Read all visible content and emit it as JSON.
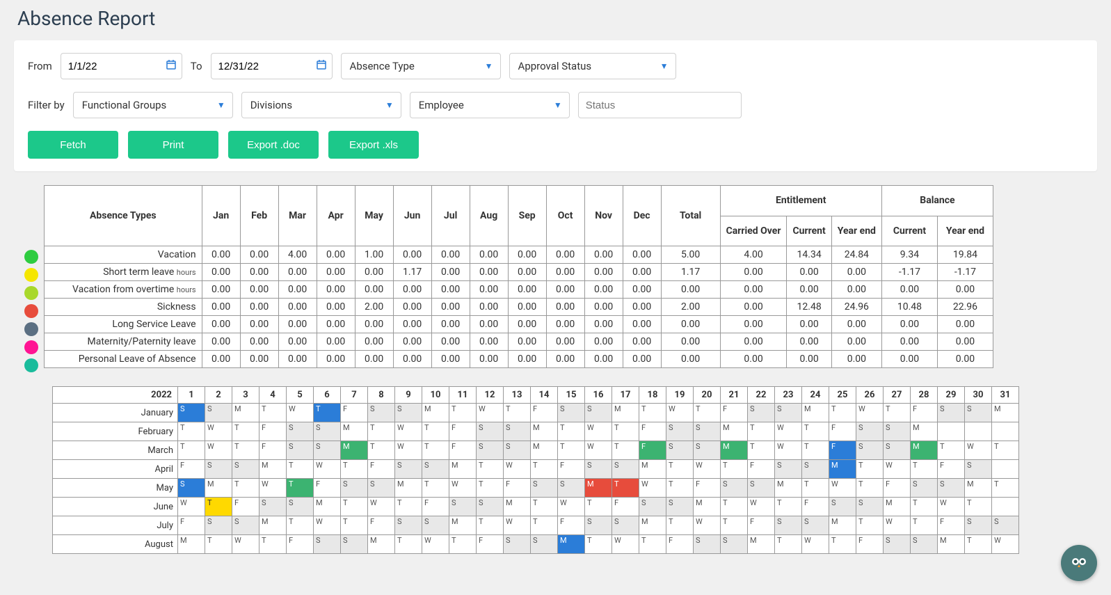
{
  "page_title": "Absence Report",
  "filters": {
    "from_label": "From",
    "from_value": "1/1/22",
    "to_label": "To",
    "to_value": "12/31/22",
    "absence_type_label": "Absence Type",
    "approval_status_label": "Approval Status",
    "filter_by_label": "Filter by",
    "functional_groups_label": "Functional Groups",
    "divisions_label": "Divisions",
    "employee_label": "Employee",
    "status_placeholder": "Status"
  },
  "buttons": {
    "fetch": "Fetch",
    "print": "Print",
    "export_doc": "Export .doc",
    "export_xls": "Export .xls"
  },
  "summary": {
    "headers": {
      "types": "Absence Types",
      "months": [
        "Jan",
        "Feb",
        "Mar",
        "Apr",
        "May",
        "Jun",
        "Jul",
        "Aug",
        "Sep",
        "Oct",
        "Nov",
        "Dec"
      ],
      "total": "Total",
      "entitlement": "Entitlement",
      "balance": "Balance",
      "carried_over": "Carried Over",
      "current": "Current",
      "year_end": "Year end",
      "bal_current": "Current",
      "bal_year_end": "Year end"
    },
    "rows": [
      {
        "color": "#2ecc40",
        "label": "Vacation",
        "unit": "",
        "months": [
          "0.00",
          "0.00",
          "4.00",
          "0.00",
          "1.00",
          "0.00",
          "0.00",
          "0.00",
          "0.00",
          "0.00",
          "0.00",
          "0.00"
        ],
        "total": "5.00",
        "carried": "4.00",
        "ent_current": "14.34",
        "ent_year_end": "24.84",
        "bal_current": "9.34",
        "bal_year_end": "19.84"
      },
      {
        "color": "#f5e600",
        "label": "Short term leave",
        "unit": "hours",
        "months": [
          "0.00",
          "0.00",
          "0.00",
          "0.00",
          "0.00",
          "1.17",
          "0.00",
          "0.00",
          "0.00",
          "0.00",
          "0.00",
          "0.00"
        ],
        "total": "1.17",
        "carried": "0.00",
        "ent_current": "0.00",
        "ent_year_end": "0.00",
        "bal_current": "-1.17",
        "bal_year_end": "-1.17"
      },
      {
        "color": "#a8d82b",
        "label": "Vacation from overtime",
        "unit": "hours",
        "months": [
          "0.00",
          "0.00",
          "0.00",
          "0.00",
          "0.00",
          "0.00",
          "0.00",
          "0.00",
          "0.00",
          "0.00",
          "0.00",
          "0.00"
        ],
        "total": "0.00",
        "carried": "0.00",
        "ent_current": "0.00",
        "ent_year_end": "0.00",
        "bal_current": "0.00",
        "bal_year_end": "0.00"
      },
      {
        "color": "#e74c3c",
        "label": "Sickness",
        "unit": "",
        "months": [
          "0.00",
          "0.00",
          "0.00",
          "0.00",
          "2.00",
          "0.00",
          "0.00",
          "0.00",
          "0.00",
          "0.00",
          "0.00",
          "0.00"
        ],
        "total": "2.00",
        "carried": "0.00",
        "ent_current": "12.48",
        "ent_year_end": "24.96",
        "bal_current": "10.48",
        "bal_year_end": "22.96"
      },
      {
        "color": "#5b6f82",
        "label": "Long Service Leave",
        "unit": "",
        "months": [
          "0.00",
          "0.00",
          "0.00",
          "0.00",
          "0.00",
          "0.00",
          "0.00",
          "0.00",
          "0.00",
          "0.00",
          "0.00",
          "0.00"
        ],
        "total": "0.00",
        "carried": "0.00",
        "ent_current": "0.00",
        "ent_year_end": "0.00",
        "bal_current": "0.00",
        "bal_year_end": "0.00"
      },
      {
        "color": "#ff1493",
        "label": "Maternity/Paternity leave",
        "unit": "",
        "months": [
          "0.00",
          "0.00",
          "0.00",
          "0.00",
          "0.00",
          "0.00",
          "0.00",
          "0.00",
          "0.00",
          "0.00",
          "0.00",
          "0.00"
        ],
        "total": "0.00",
        "carried": "0.00",
        "ent_current": "0.00",
        "ent_year_end": "0.00",
        "bal_current": "0.00",
        "bal_year_end": "0.00"
      },
      {
        "color": "#1abc9c",
        "label": "Personal Leave of Absence",
        "unit": "",
        "months": [
          "0.00",
          "0.00",
          "0.00",
          "0.00",
          "0.00",
          "0.00",
          "0.00",
          "0.00",
          "0.00",
          "0.00",
          "0.00",
          "0.00"
        ],
        "total": "0.00",
        "carried": "0.00",
        "ent_current": "0.00",
        "ent_year_end": "0.00",
        "bal_current": "0.00",
        "bal_year_end": "0.00"
      }
    ]
  },
  "calendar": {
    "year": "2022",
    "months": [
      {
        "name": "January",
        "start": 5,
        "len": 31,
        "marks": {
          "1": "blue",
          "6": "blue"
        }
      },
      {
        "name": "February",
        "start": 1,
        "len": 28,
        "marks": {}
      },
      {
        "name": "March",
        "start": 1,
        "len": 31,
        "marks": {
          "7": "green",
          "18": "green",
          "21": "green",
          "25": "blue",
          "28": "green"
        }
      },
      {
        "name": "April",
        "start": 4,
        "len": 30,
        "marks": {
          "25": "blue"
        }
      },
      {
        "name": "May",
        "start": 6,
        "len": 31,
        "marks": {
          "1": "blue",
          "5": "green",
          "16": "red",
          "17": "red"
        }
      },
      {
        "name": "June",
        "start": 2,
        "len": 30,
        "marks": {
          "2": "yellow"
        }
      },
      {
        "name": "July",
        "start": 4,
        "len": 31,
        "marks": {}
      },
      {
        "name": "August",
        "start": 0,
        "len": 31,
        "marks": {
          "15": "blue"
        }
      }
    ]
  }
}
